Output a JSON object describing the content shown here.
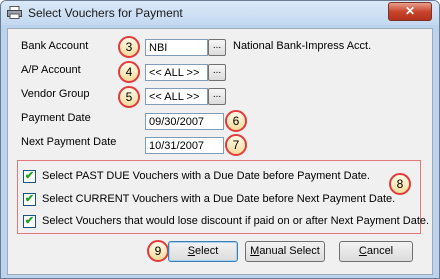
{
  "window": {
    "title": "Select Vouchers for Payment",
    "close_glyph": "✕"
  },
  "fields": {
    "bank_account": {
      "label": "Bank Account",
      "value": "NBI",
      "button": "...",
      "description": "National Bank-Impress Acct."
    },
    "ap_account": {
      "label": "A/P Account",
      "value": "<< ALL >>",
      "button": "..."
    },
    "vendor_group": {
      "label": "Vendor Group",
      "value": "<< ALL >>",
      "button": "..."
    },
    "payment_date": {
      "label": "Payment Date",
      "value": "09/30/2007"
    },
    "next_payment_date": {
      "label": "Next Payment Date",
      "value": "10/31/2007"
    }
  },
  "options": [
    {
      "label": "Select PAST DUE Vouchers with a Due Date before Payment Date.",
      "checked": true
    },
    {
      "label": "Select CURRENT Vouchers with a Due Date before Next Payment Date.",
      "checked": true
    },
    {
      "label": "Select Vouchers that would lose discount if paid on or after Next Payment Date.",
      "checked": true
    }
  ],
  "buttons": {
    "select": {
      "first": "S",
      "rest": "elect"
    },
    "manual_select": {
      "first": "M",
      "rest": "anual Select"
    },
    "cancel": {
      "first": "C",
      "rest": "ancel"
    }
  },
  "callouts": [
    "3",
    "4",
    "5",
    "6",
    "7",
    "8",
    "9"
  ],
  "icons": {
    "app": "printer-icon",
    "check": "checkmark-icon"
  },
  "colors": {
    "callout_border": "#e23b3b",
    "callout_fill": "#f4dc9c",
    "options_border": "#e2787a",
    "check": "#21a121"
  }
}
